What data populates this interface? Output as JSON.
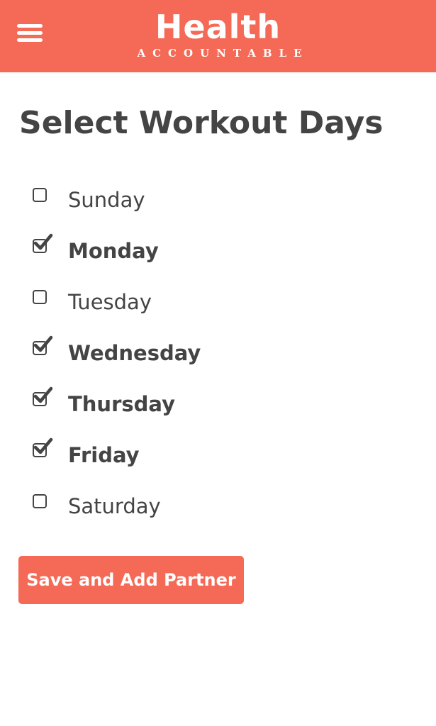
{
  "header": {
    "brand_name": "Health",
    "brand_subtitle": "ACCOUNTABLE",
    "menu_icon": "hamburger-menu-icon",
    "background_color": "#f56a56"
  },
  "main": {
    "title": "Select Workout Days",
    "days": [
      {
        "label": "Sunday",
        "checked": false
      },
      {
        "label": "Monday",
        "checked": true
      },
      {
        "label": "Tuesday",
        "checked": false
      },
      {
        "label": "Wednesday",
        "checked": true
      },
      {
        "label": "Thursday",
        "checked": true
      },
      {
        "label": "Friday",
        "checked": true
      },
      {
        "label": "Saturday",
        "checked": false
      }
    ],
    "save_button_label": "Save and Add Partner"
  },
  "colors": {
    "accent": "#f56a56",
    "text": "#444444",
    "background": "#ffffff"
  }
}
